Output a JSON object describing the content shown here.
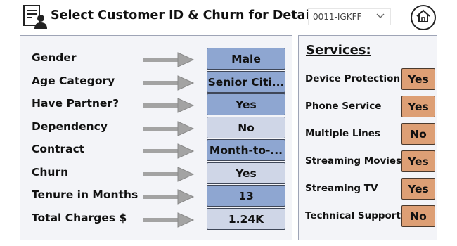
{
  "header": {
    "title": "Select Customer ID & Churn for Details",
    "customer_select": {
      "value": "0011-IGKFF"
    },
    "home_icon": "home-icon",
    "title_icon": "customer-details-icon"
  },
  "details": [
    {
      "label": "Gender",
      "value": "Male"
    },
    {
      "label": "Age Category",
      "value": "Senior Citi..."
    },
    {
      "label": "Have Partner?",
      "value": "Yes"
    },
    {
      "label": "Dependency",
      "value": "No"
    },
    {
      "label": "Contract",
      "value": "Month-to-..."
    },
    {
      "label": "Churn",
      "value": "Yes"
    },
    {
      "label": "Tenure in Months",
      "value": "13"
    },
    {
      "label": "Total Charges $",
      "value": "1.24K"
    }
  ],
  "services": {
    "title": "Services:",
    "items": [
      {
        "label": "Device Protection",
        "value": "Yes"
      },
      {
        "label": "Phone Service",
        "value": "Yes"
      },
      {
        "label": "Multiple Lines",
        "value": "No"
      },
      {
        "label": "Streaming Movies",
        "value": "Yes"
      },
      {
        "label": "Streaming TV",
        "value": "Yes"
      },
      {
        "label": "Technical Support",
        "value": "No"
      }
    ]
  },
  "colors": {
    "value_dark": "#8ea6d1",
    "value_light": "#cfd6e7",
    "service_box": "#dd9f75",
    "panel_bg": "#f3f4f8",
    "arrow": "#a3a3a3"
  }
}
